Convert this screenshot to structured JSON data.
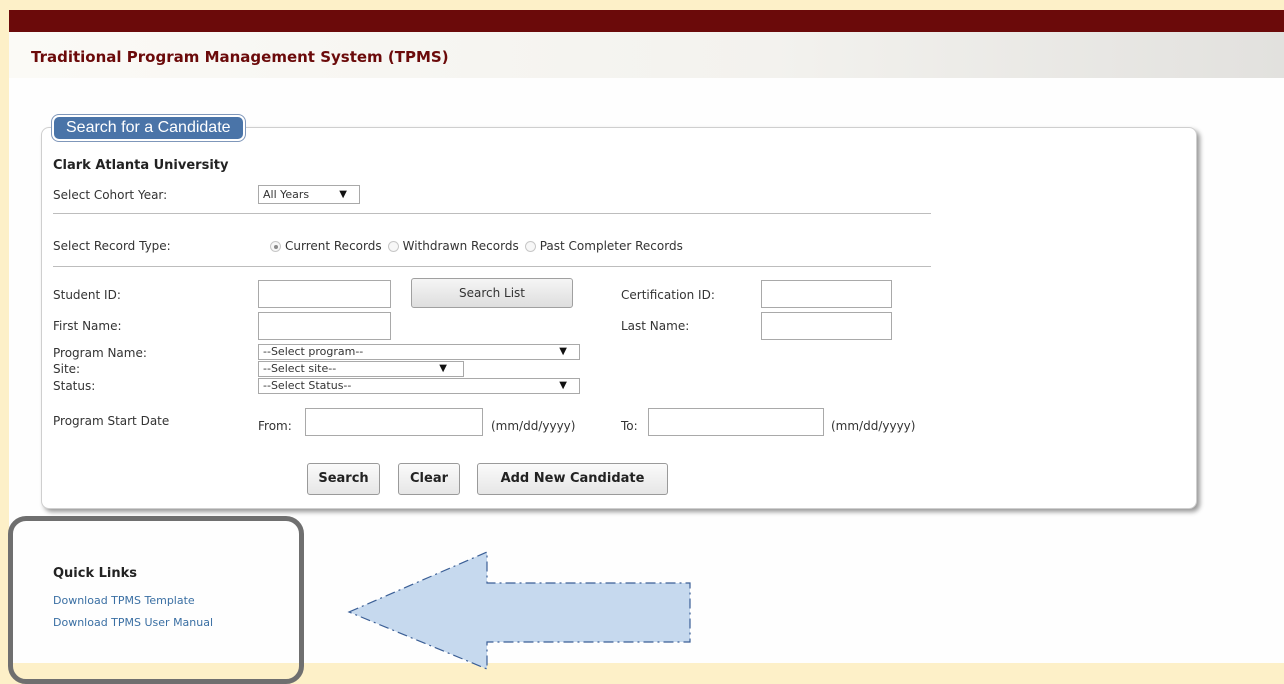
{
  "header": {
    "title": "Traditional Program Management System (TPMS)"
  },
  "panel": {
    "legend": "Search for a Candidate",
    "organization": "Clark Atlanta University",
    "cohort": {
      "label": "Select Cohort Year:",
      "value": "All Years"
    },
    "record_type": {
      "label": "Select Record Type:",
      "options": [
        "Current Records",
        "Withdrawn Records",
        "Past Completer Records"
      ],
      "selected": "Current Records"
    },
    "fields": {
      "student_id_label": "Student ID:",
      "search_list_label": "Search List",
      "certification_id_label": "Certification ID:",
      "first_name_label": "First Name:",
      "last_name_label": "Last Name:",
      "program_name_label": "Program Name:",
      "program_name_value": "--Select program--",
      "site_label": "Site:",
      "site_value": "--Select site--",
      "status_label": "Status:",
      "status_value": "--Select Status--",
      "start_date_label": "Program Start Date",
      "from_label": "From:",
      "to_label": "To:",
      "date_format": "(mm/dd/yyyy)"
    },
    "buttons": {
      "search": "Search",
      "clear": "Clear",
      "add_new": "Add New Candidate"
    }
  },
  "quick_links": {
    "title": "Quick Links",
    "links": [
      "Download TPMS Template",
      "Download TPMS User Manual"
    ]
  },
  "colors": {
    "brand_maroon": "#6b0a0a",
    "legend_blue": "#4a74a8",
    "link_blue": "#3a6fa3",
    "annotation_arrow_fill": "#c6d9ee",
    "annotation_arrow_stroke": "#3b5f96",
    "page_background": "#fdf0c8"
  },
  "icons": {
    "dropdown": "triangle-down",
    "annotation": "left-arrow-annotation"
  }
}
